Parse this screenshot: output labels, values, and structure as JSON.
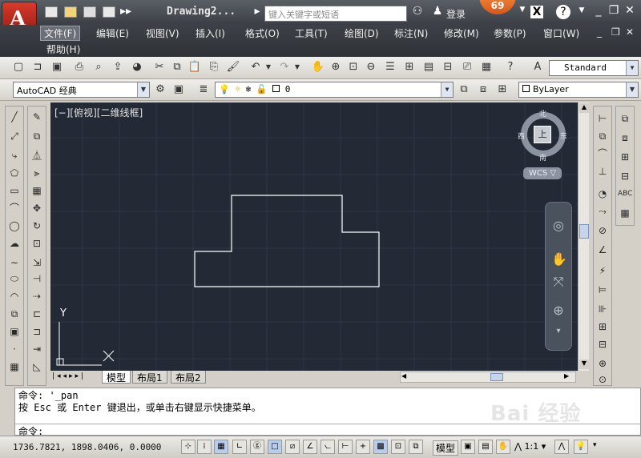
{
  "title_bar": {
    "document_title": "Drawing2...",
    "search_placeholder": "键入关键字或短语",
    "login_label": "登录",
    "badge_count": "69",
    "help_icon": "question-icon"
  },
  "menu": {
    "items": [
      "文件(F)",
      "编辑(E)",
      "视图(V)",
      "插入(I)",
      "格式(O)",
      "工具(T)",
      "绘图(D)",
      "标注(N)",
      "修改(M)",
      "参数(P)",
      "窗口(W)",
      "帮助(H)"
    ]
  },
  "toolbars": {
    "text_style": "Standard",
    "workspace": "AutoCAD 经典",
    "layer": "0",
    "color": "ByLayer"
  },
  "canvas": {
    "view_label": "[−][俯视][二维线框]",
    "viewcube": {
      "north": "北",
      "south": "南",
      "east": "东",
      "west": "西",
      "face": "上"
    },
    "wcs_label": "WCS ▽",
    "ucs_y_label": "Y",
    "background": "#232a36",
    "drawing_color": "#ffffff"
  },
  "tabs": [
    "模型",
    "布局1",
    "布局2"
  ],
  "command": {
    "line1": "命令: '_pan",
    "line2": "按 Esc 或 Enter 键退出，或单击右键显示快捷菜单。",
    "prompt": "命令:"
  },
  "status": {
    "coordinates": "1736.7821, 1898.0406, 0.0000",
    "model_label": "模型",
    "scale": "1:1"
  },
  "watermark": "Bai 经验"
}
